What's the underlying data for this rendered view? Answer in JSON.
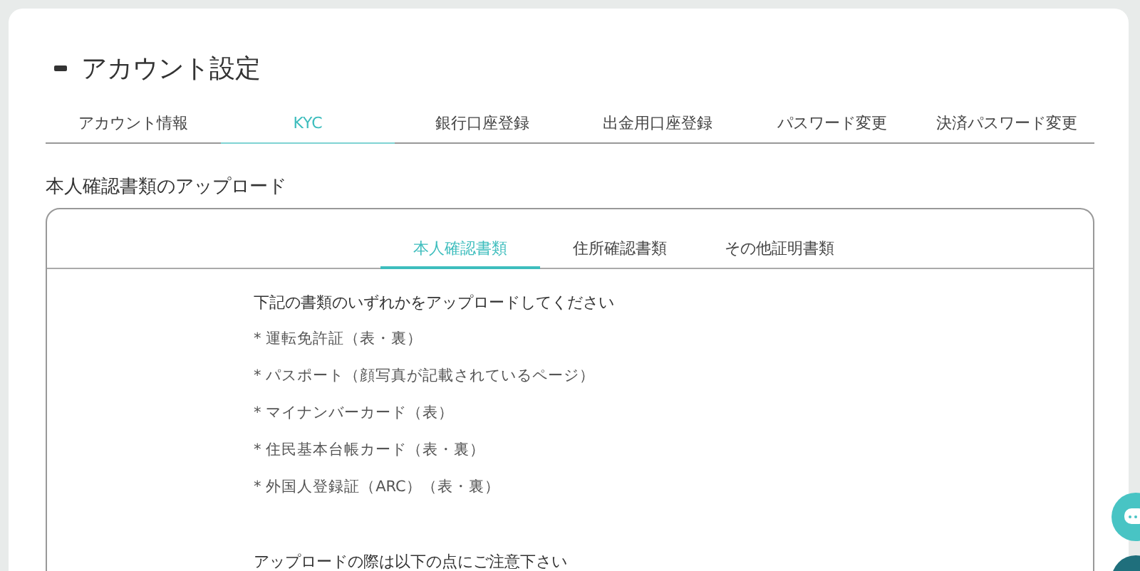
{
  "page_title": "アカウント設定",
  "tabs": [
    {
      "label": "アカウント情報",
      "selected": false
    },
    {
      "label": "KYC",
      "selected": true
    },
    {
      "label": "銀行口座登録",
      "selected": false
    },
    {
      "label": "出金用口座登録",
      "selected": false
    },
    {
      "label": "パスワード変更",
      "selected": false
    },
    {
      "label": "決済パスワード変更",
      "selected": false
    }
  ],
  "section_title": "本人確認書類のアップロード",
  "doc_tabs": [
    {
      "label": "本人確認書類",
      "selected": true
    },
    {
      "label": "住所確認書類",
      "selected": false
    },
    {
      "label": "その他証明書類",
      "selected": false
    }
  ],
  "instruction": "下記の書類のいずれかをアップロードしてください",
  "documents": [
    "* 運転免許証（表・裏）",
    "* パスポート（顔写真が記載されているページ）",
    "* マイナンバーカード（表）",
    "* 住民基本台帳カード（表・裏）",
    "* 外国人登録証（ARC）（表・裏）"
  ],
  "notes_title": "アップロードの際は以下の点にご注意下さい"
}
